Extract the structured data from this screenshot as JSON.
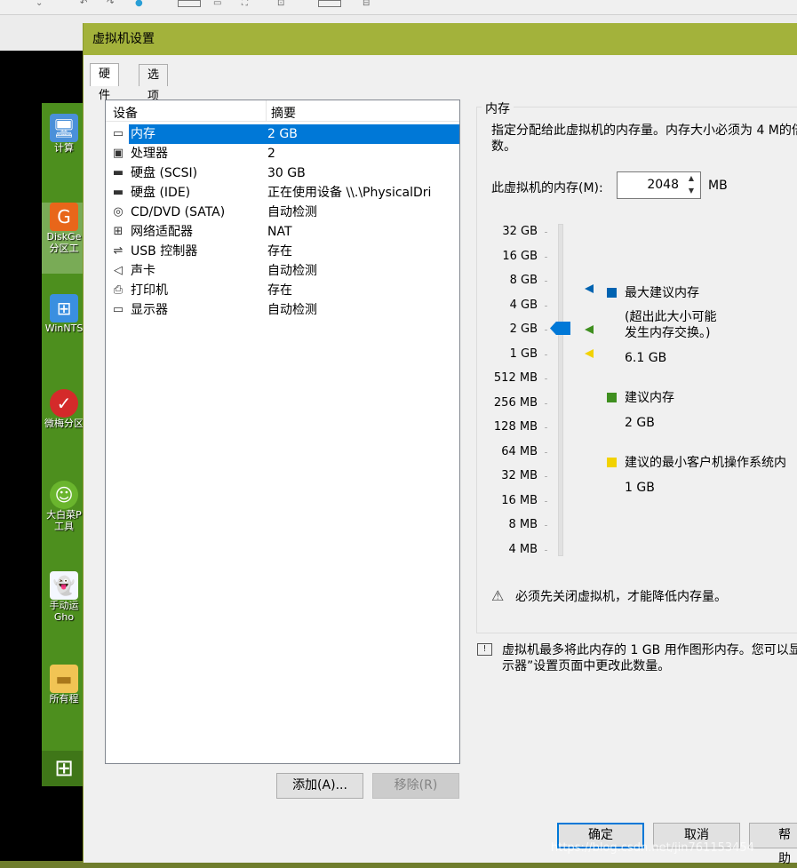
{
  "dialog": {
    "title": "虚拟机设置",
    "tabs": [
      "硬件",
      "选项"
    ]
  },
  "device_list": {
    "headers": {
      "device": "设备",
      "summary": "摘要"
    },
    "rows": [
      {
        "icon": "memory-icon",
        "name": "内存",
        "summary": "2 GB",
        "selected": true
      },
      {
        "icon": "processor-icon",
        "name": "处理器",
        "summary": "2"
      },
      {
        "icon": "hard-disk-icon",
        "name": "硬盘 (SCSI)",
        "summary": "30 GB"
      },
      {
        "icon": "hard-disk-icon",
        "name": "硬盘 (IDE)",
        "summary": "正在使用设备 \\\\.\\PhysicalDri"
      },
      {
        "icon": "cd-dvd-icon",
        "name": "CD/DVD (SATA)",
        "summary": "自动检测"
      },
      {
        "icon": "network-adapter-icon",
        "name": "网络适配器",
        "summary": "NAT"
      },
      {
        "icon": "usb-icon",
        "name": "USB 控制器",
        "summary": "存在"
      },
      {
        "icon": "speaker-icon",
        "name": "声卡",
        "summary": "自动检测"
      },
      {
        "icon": "printer-icon",
        "name": "打印机",
        "summary": "存在"
      },
      {
        "icon": "display-icon",
        "name": "显示器",
        "summary": "自动检测"
      }
    ],
    "add_button": "添加(A)...",
    "remove_button": "移除(R)"
  },
  "memory": {
    "group_title": "内存",
    "description": "指定分配给此虚拟机的内存量。内存大小必须为 4 M的倍数。",
    "input_label": "此虚拟机的内存(M):",
    "value": "2048",
    "unit": "MB",
    "scale": [
      "32 GB",
      "16 GB",
      "8 GB",
      "4 GB",
      "2 GB",
      "1 GB",
      "512 MB",
      "256 MB",
      "128 MB",
      "64 MB",
      "32 MB",
      "16 MB",
      "8 MB",
      "4 MB"
    ],
    "slider_value": "2 GB",
    "legend": {
      "max": {
        "label": "最大建议内存",
        "note_line1": "(超出此大小可能",
        "note_line2": "发生内存交换。)",
        "value": "6.1 GB",
        "color": "#0063b1"
      },
      "recommended": {
        "label": "建议内存",
        "value": "2 GB",
        "color": "#3f8f1f"
      },
      "min": {
        "label": "建议的最小客户机操作系统内",
        "value": "1 GB",
        "color": "#f2d200"
      }
    },
    "warning": "必须先关闭虚拟机，才能降低内存量。",
    "info": "虚拟机最多将此内存的 1 GB 用作图形内存。您可以显示器”设置页面中更改此数量。"
  },
  "footer": {
    "ok": "确定",
    "cancel": "取消",
    "help": "帮助"
  },
  "desktop": {
    "icons": [
      {
        "name": "computer-icon",
        "label": "计算",
        "color": "#4a90d9"
      },
      {
        "name": "diskgenius-icon",
        "label": "DiskGe",
        "label2": "分区工",
        "color": "#e8661a"
      },
      {
        "name": "winnt-setup-icon",
        "label": "WinNTS",
        "color": "#3a8fe0"
      },
      {
        "name": "partition-tool-icon",
        "label": "微梅分区",
        "color": "#d42a2a"
      },
      {
        "name": "dabaicai-icon",
        "label": "大白菜P",
        "label2": "工具",
        "color": "#6ab52d"
      },
      {
        "name": "ghost-icon",
        "label": "手动运",
        "label2": "Gho",
        "color": "#f4f7ff"
      },
      {
        "name": "folder-icon",
        "label": "所有程",
        "color": "#f1c454"
      }
    ]
  },
  "watermark": "https://blog.csdn.net/jin761153454"
}
